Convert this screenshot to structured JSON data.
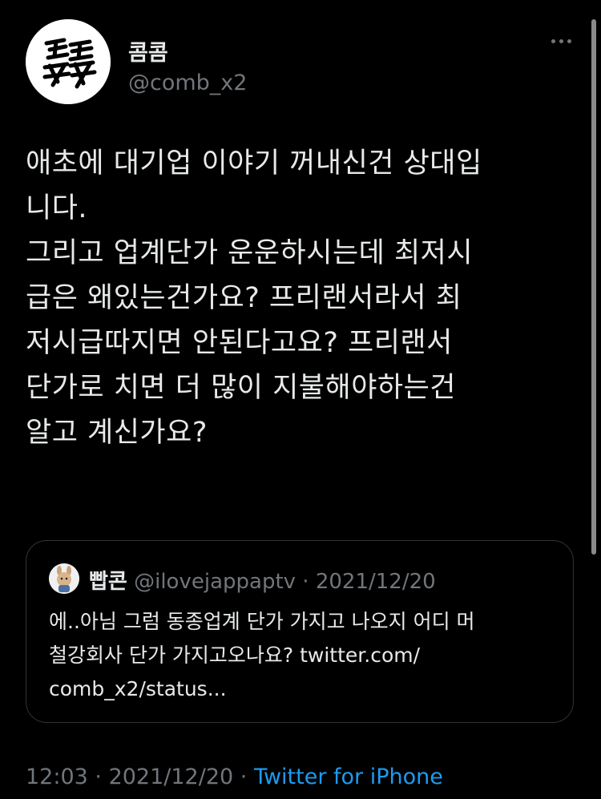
{
  "author": {
    "display_name": "콤콤",
    "handle": "@comb_x2"
  },
  "tweet": {
    "text": "애초에 대기업 이야기 꺼내신건 상대입\n니다.\n그리고 업계단가 운운하시는데 최저시\n급은 왜있는건가요? 프리랜서라서 최\n저시급따지면 안된다고요? 프리랜서\n단가로 치면 더 많이 지불해야하는건\n알고 계신가요?"
  },
  "quote": {
    "display_name": "빱콘",
    "handle": "@ilovejappaptv",
    "separator": "·",
    "date": "2021/12/20",
    "text": "에..아님 그럼 동종업계 단가 가지고 나오지 어디 머\n철강회사 단가 가지고오나요? twitter.com/\ncomb_x2/status..."
  },
  "footer": {
    "time": "12:03",
    "sep1": " · ",
    "date": "2021/12/20",
    "sep2": " · ",
    "source": "Twitter for iPhone"
  },
  "icons": {
    "more": "more-horizontal-icon"
  },
  "colors": {
    "background": "#000000",
    "text": "#e7e9ea",
    "secondary": "#71767b",
    "link": "#1d9bf0",
    "border": "#2f3336"
  }
}
